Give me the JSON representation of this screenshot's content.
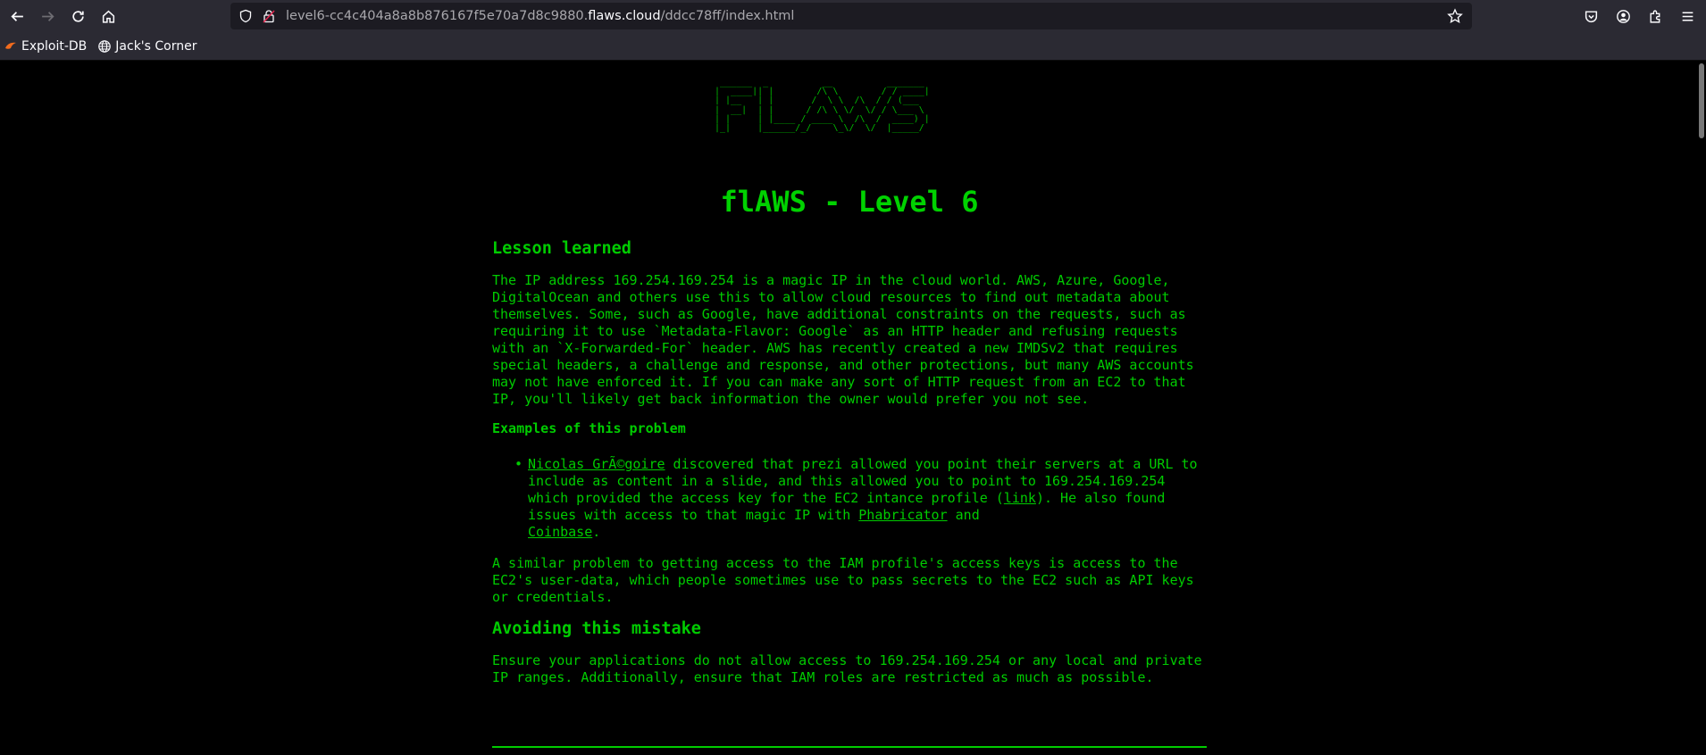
{
  "browser": {
    "url": {
      "prefix": "level6-cc4c404a8a8b876167f5e70a7d8c9880.",
      "host": "flaws.cloud",
      "path": "/ddcc78ff/index.html"
    },
    "bookmarks": [
      {
        "label": "Exploit-DB",
        "icon": "exploit-db-icon"
      },
      {
        "label": "Jack's Corner",
        "icon": "globe-icon"
      }
    ]
  },
  "page": {
    "ascii_logo": " ______  _          __          _______\n|  ____|| |        /\\ \\        / / ____|\n| |__   | |       /  \\ \\  /\\  / / (___\n|  __|  | |      / /\\ \\ \\/  \\/ / \\___ \\\n| |     | |____ / ____ \\  /\\  /  ____) |\n|_|     |______/_/    \\_\\/  \\/  |_____/",
    "title": "flAWS - Level 6",
    "lesson_heading": "Lesson learned",
    "lesson_text": "The IP address 169.254.169.254 is a magic IP in the cloud world. AWS, Azure, Google, DigitalOcean and others use this to allow cloud resources to find out metadata about themselves. Some, such as Google, have additional constraints on the requests, such as requiring it to use `Metadata-Flavor: Google` as an HTTP header and refusing requests with an `X-Forwarded-For` header. AWS has recently created a new IMDSv2 that requires special headers, a challenge and response, and other protections, but many AWS accounts may not have enforced it. If you can make any sort of HTTP request from an EC2 to that IP, you'll likely get back information the owner would prefer you not see.",
    "examples_heading": "Examples of this problem",
    "example": {
      "author_link": "Nicolas GrÃ©goire",
      "text1": " discovered that prezi allowed you point their servers at a URL to include as content in a slide, and this allowed you to point to 169.254.169.254 which provided the access key for the EC2 intance profile (",
      "link_label": "link",
      "text2": "). He also found issues with access to that magic IP with ",
      "phabricator_link": "Phabricator",
      "text3": " and ",
      "coinbase_link": "Coinbase",
      "text4": "."
    },
    "similar_text": "A similar problem to getting access to the IAM profile's access keys is access to the EC2's user-data, which people sometimes use to pass secrets to the EC2 such as API keys or credentials.",
    "avoiding_heading": "Avoiding this mistake",
    "avoiding_text": "Ensure your applications do not allow access to 169.254.169.254 or any local and private IP ranges. Additionally, ensure that IAM roles are restricted as much as possible."
  },
  "colors": {
    "text_green": "#00cc00",
    "background": "#000000",
    "chrome": "#2b2a33"
  }
}
